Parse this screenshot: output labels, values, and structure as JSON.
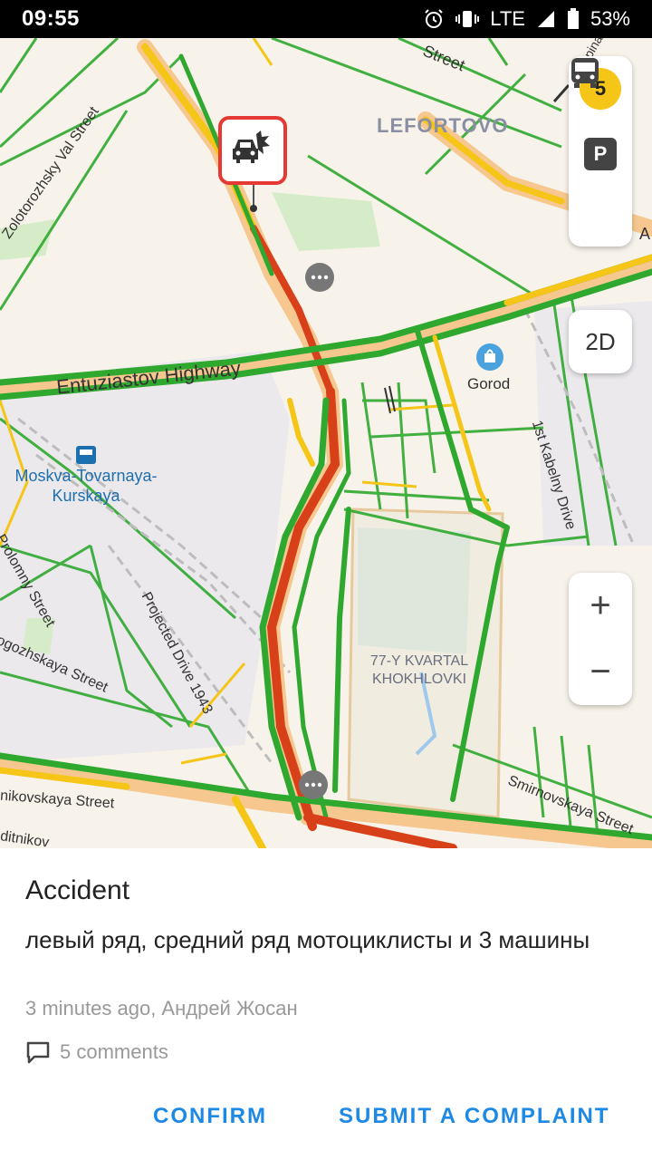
{
  "status_bar": {
    "time": "09:55",
    "network": "LTE",
    "battery": "53%"
  },
  "map": {
    "district": "LEFORTOVO",
    "poi": "Gorod",
    "station": {
      "line1": "Moskva-Tovarnaya-",
      "line2": "Kurskaya"
    },
    "area": {
      "line1": "77-Y KVARTAL",
      "line2": "KHOKHLOVKI"
    },
    "roads": {
      "highway": "Entuziastov Highway",
      "val_street": "Zolotorozhsky Val Street",
      "top_street": "Street",
      "top_right": "A",
      "kabelny": "1st Kabelny Drive",
      "projected": "Projected Drive 1943",
      "prog": "Prolomny Street",
      "rogozh": "Rogozhskaya Street",
      "smirnov": "Smirnovskaya Street",
      "nikovskaya": "nikovskaya Street",
      "ditnikov": "ditnikov",
      "lapina": "Lapina"
    },
    "controls": {
      "layer_badge": "5",
      "parking": "P",
      "btn_2d": "2D",
      "zoom_in": "+",
      "zoom_out": "−"
    },
    "colors": {
      "free": "#2fa82f",
      "slow": "#f5c518",
      "jam": "#d8401a",
      "road": "#f6c890",
      "accident": "#e53935"
    }
  },
  "card": {
    "title": "Accident",
    "description": "левый ряд, средний ряд мотоциклисты и 3 машины",
    "meta": "3 minutes ago, Андрей Жосан",
    "comments": "5 comments",
    "confirm": "CONFIRM",
    "complaint": "SUBMIT A COMPLAINT"
  }
}
